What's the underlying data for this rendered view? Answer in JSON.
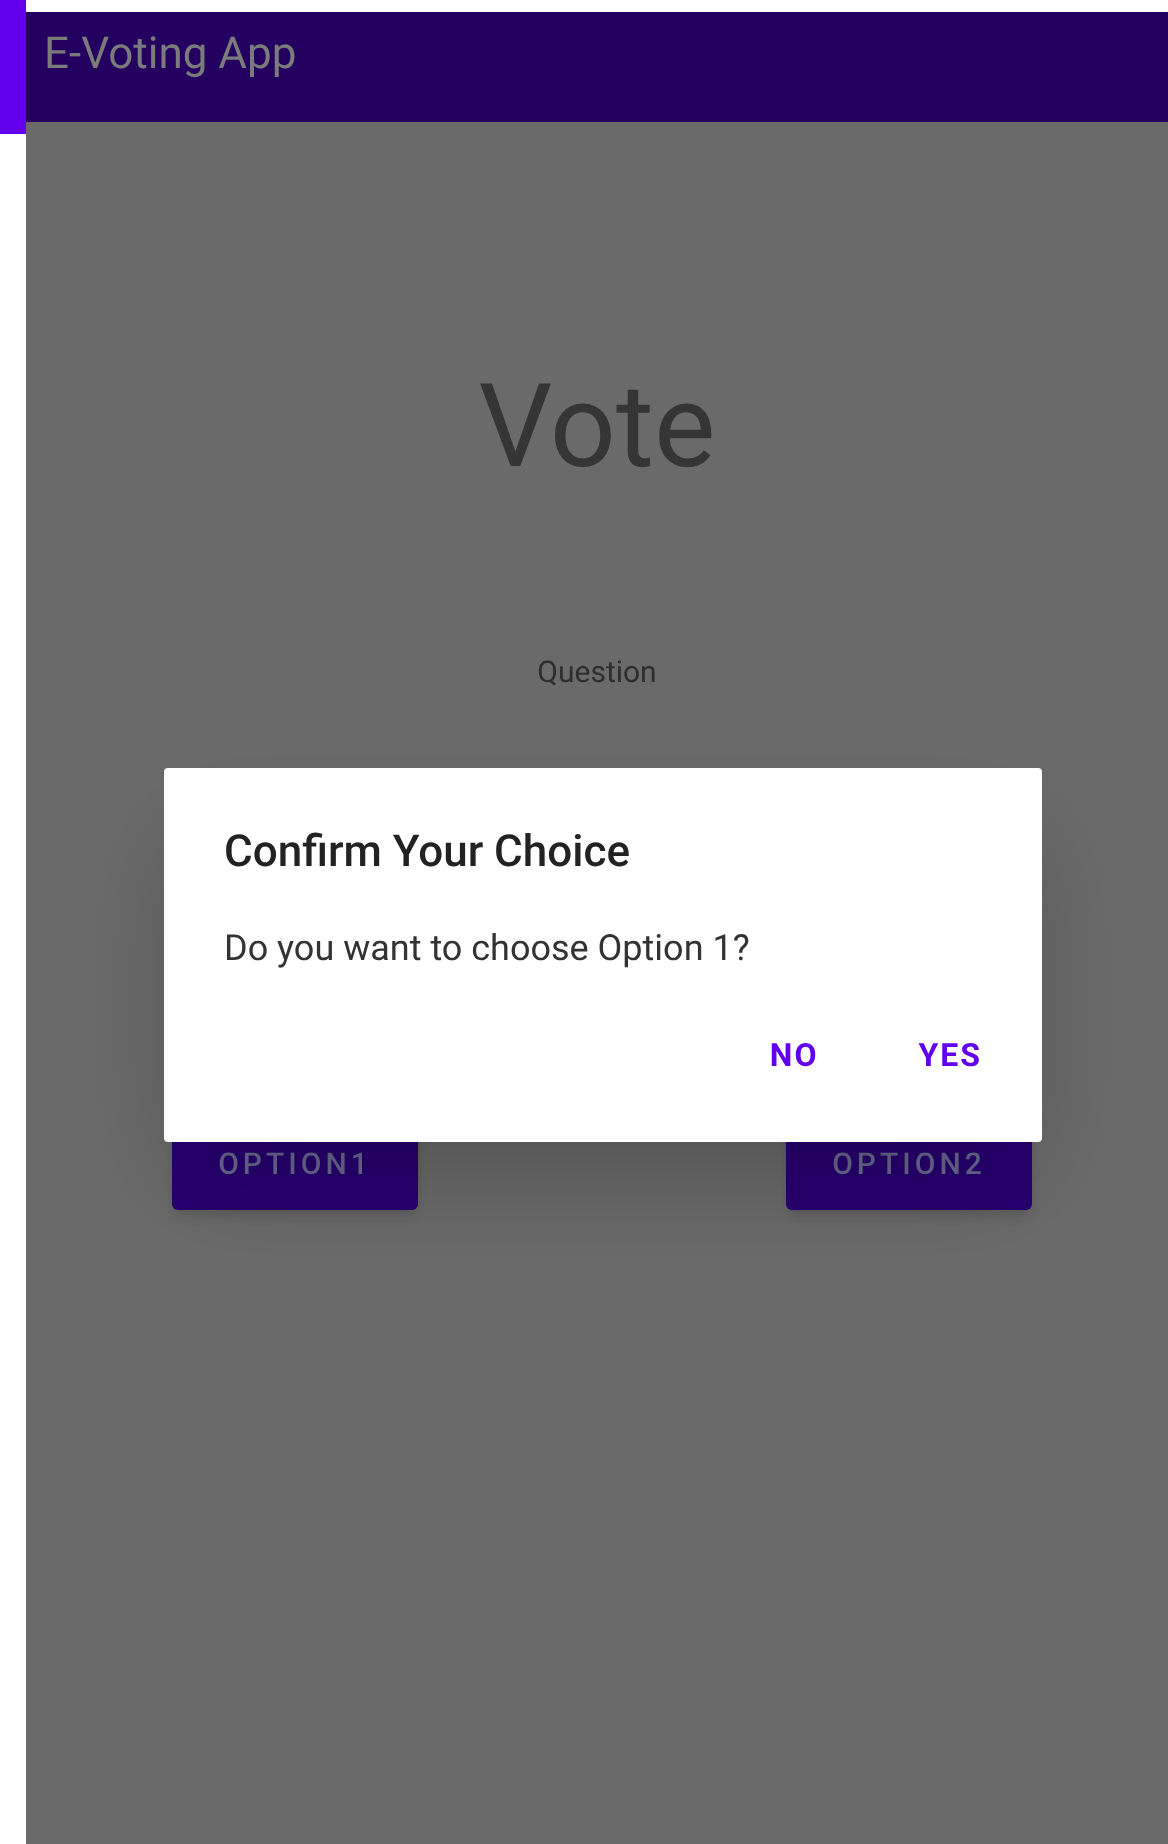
{
  "app_bar": {
    "title": "E-Voting App"
  },
  "heading": "Vote",
  "question": "Question",
  "options": [
    {
      "label": "OPTION1"
    },
    {
      "label": "OPTION2"
    }
  ],
  "dialog": {
    "title": "Confirm Your Choice",
    "message": "Do you want to choose Option 1?",
    "buttons": [
      {
        "label": "NO"
      },
      {
        "label": "YES"
      }
    ]
  }
}
